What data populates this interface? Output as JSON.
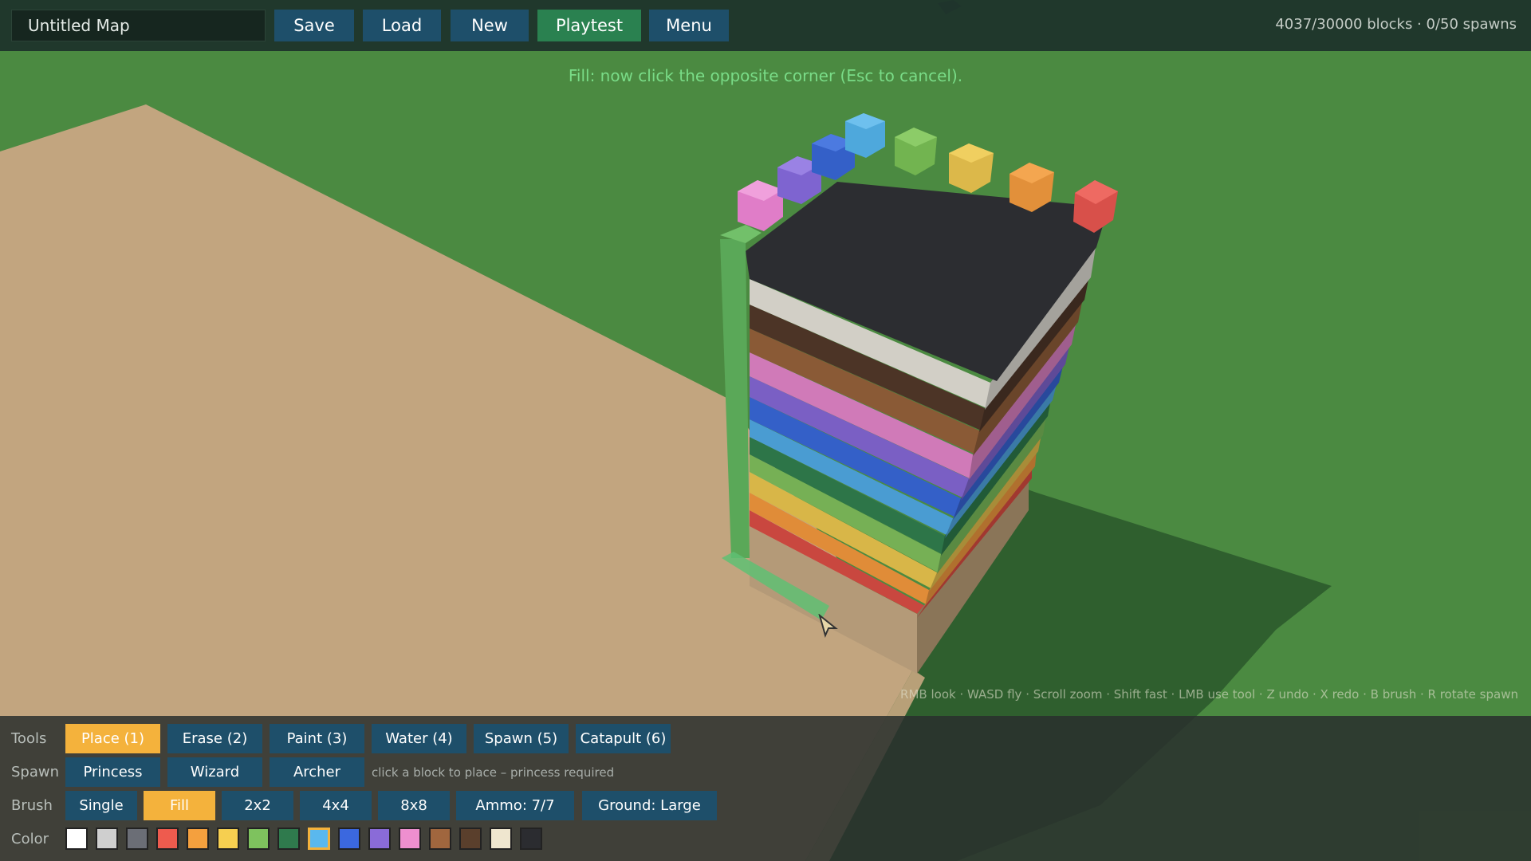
{
  "topbar": {
    "map_name": "Untitled Map",
    "buttons": [
      "Save",
      "Load",
      "New",
      "Playtest",
      "Menu"
    ],
    "stats": "4037/30000 blocks · 0/50 spawns"
  },
  "hint": "Fill: now click the opposite corner (Esc to cancel).",
  "shortcuts": "RMB look  ·  WASD fly  ·  Scroll zoom  ·  Shift fast  ·  LMB use tool  ·  Z undo  ·  X redo  ·  B brush  ·  R rotate spawn",
  "panel": {
    "tools_label": "Tools",
    "tools": [
      "Place (1)",
      "Erase (2)",
      "Paint (3)",
      "Water (4)",
      "Spawn (5)",
      "Catapult (6)"
    ],
    "active_tool": "Place (1)",
    "spawn_label": "Spawn",
    "spawns": [
      "Princess",
      "Wizard",
      "Archer"
    ],
    "spawn_hint": "click a block to place – princess required",
    "brush_label": "Brush",
    "brushes": [
      "Single",
      "Fill",
      "2x2",
      "4x4",
      "8x8",
      "Ammo: 7/7",
      "Ground: Large"
    ],
    "active_brush": "Fill",
    "color_label": "Color",
    "colors": [
      "#ffffff",
      "#cfcfcf",
      "#6b6e76",
      "#ee5b4e",
      "#f4a03e",
      "#f6cf50",
      "#7ec25e",
      "#2f7a4d",
      "#5ab8ee",
      "#3b68df",
      "#8a6bd8",
      "#ee8fcf",
      "#a0663e",
      "#5a3f2c",
      "#efe6cf",
      "#2b2c30"
    ],
    "selected_color": "#5ab8ee"
  },
  "scene": {
    "ground_color": "#4a8a40",
    "sand_color": "#c2a57f",
    "tower_stripes": [
      "#c2a57f",
      "#d84b41",
      "#e8903a",
      "#e0bd4a",
      "#7ab458",
      "#2d7548",
      "#4c9fd4",
      "#3460c8",
      "#7a5fc4",
      "#d07ab8",
      "#8a5a36",
      "#4c3426",
      "#cdcac2",
      "#2c2d31"
    ],
    "top_cubes": [
      "#e07dc8",
      "#7e64d0",
      "#3460c8",
      "#4ea8dc",
      "#72b450",
      "#dcb84a",
      "#e2903a",
      "#d8504a"
    ]
  }
}
